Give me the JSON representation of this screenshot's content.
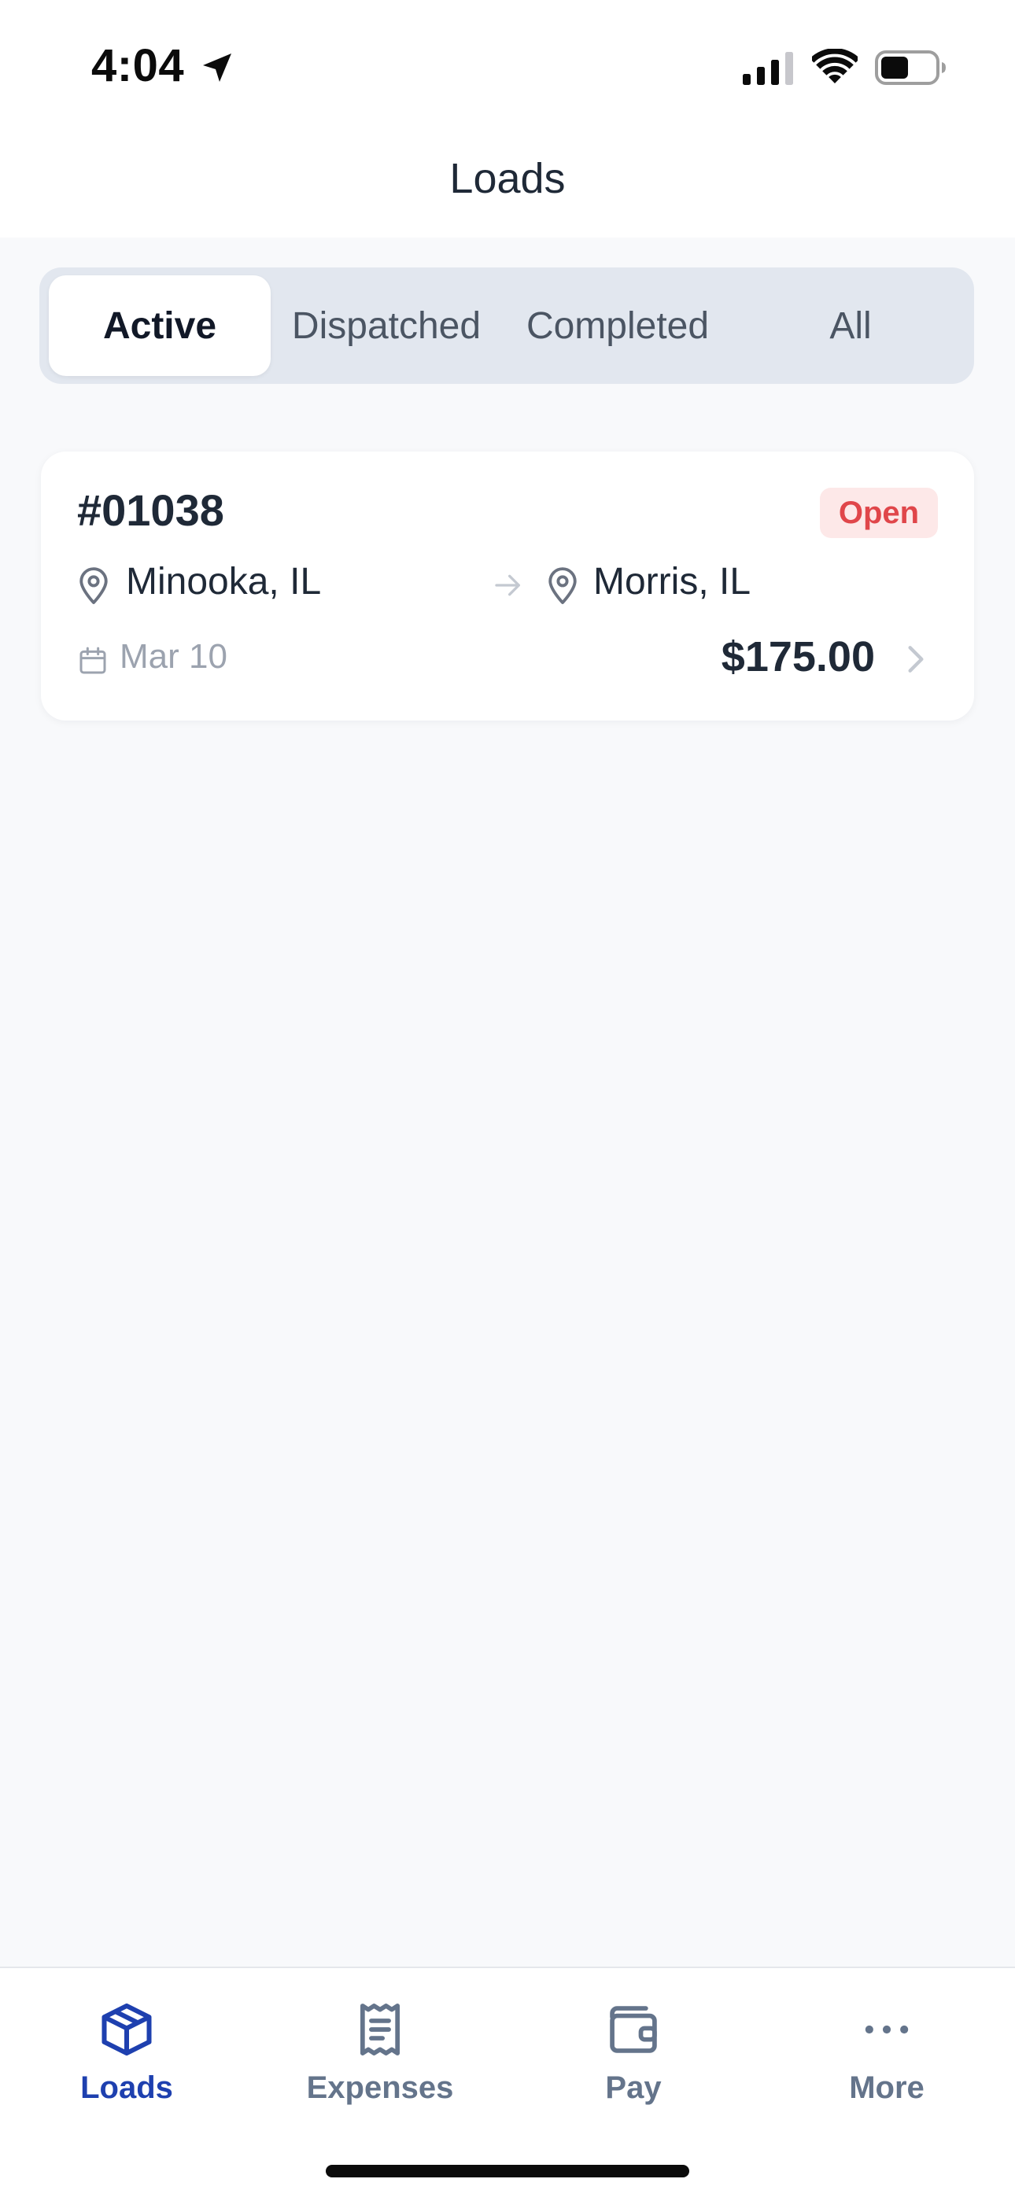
{
  "status_bar": {
    "time": "4:04",
    "icons": [
      "location-arrow-icon",
      "cellular-signal-icon",
      "wifi-icon",
      "battery-icon"
    ]
  },
  "header": {
    "title": "Loads"
  },
  "filter_tabs": [
    {
      "label": "Active",
      "selected": true
    },
    {
      "label": "Dispatched",
      "selected": false
    },
    {
      "label": "Completed",
      "selected": false
    },
    {
      "label": "All",
      "selected": false
    }
  ],
  "loads": [
    {
      "number": "#01038",
      "status": "Open",
      "origin": "Minooka, IL",
      "destination": "Morris, IL",
      "date": "Mar 10",
      "amount": "$175.00"
    }
  ],
  "tab_bar": {
    "items": [
      {
        "label": "Loads",
        "icon": "box-icon",
        "active": true
      },
      {
        "label": "Expenses",
        "icon": "receipt-icon",
        "active": false
      },
      {
        "label": "Pay",
        "icon": "wallet-icon",
        "active": false
      },
      {
        "label": "More",
        "icon": "ellipsis-icon",
        "active": false
      }
    ]
  },
  "colors": {
    "accent": "#1e40af",
    "status_open_text": "#e0464a",
    "status_open_bg": "#fde8e8",
    "background": "#f8f9fb"
  }
}
